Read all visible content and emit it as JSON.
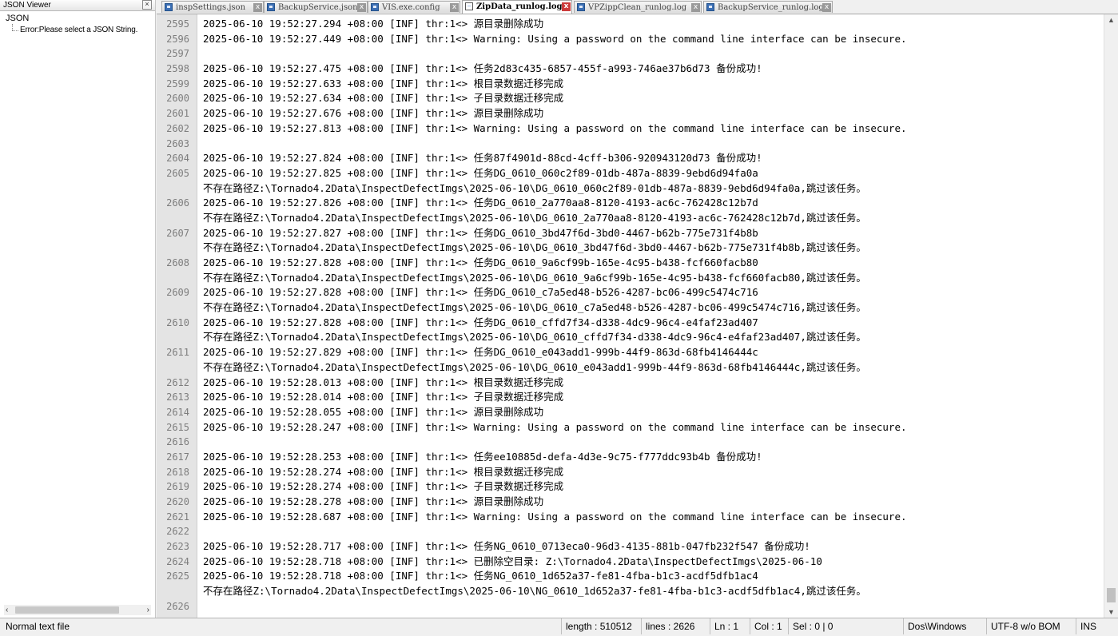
{
  "json_viewer": {
    "title": "JSON Viewer",
    "close": "×",
    "root": "JSON",
    "error": "Error:Please select a JSON String.",
    "scroll_left": "‹",
    "scroll_right": "›"
  },
  "tabs": [
    {
      "label": "inspSettings.json",
      "active": false
    },
    {
      "label": "BackupService.json",
      "active": false
    },
    {
      "label": "VIS.exe.config",
      "active": false
    },
    {
      "label": "ZipData_runlog.log",
      "active": true
    },
    {
      "label": "VPZippClean_runlog.log",
      "active": false
    },
    {
      "label": "BackupService_runlog.log",
      "active": false
    }
  ],
  "editor": {
    "lines": [
      {
        "n": "2595",
        "t": "2025-06-10 19:52:27.294 +08:00 [INF] thr:1<> 源目录删除成功"
      },
      {
        "n": "2596",
        "t": "2025-06-10 19:52:27.449 +08:00 [INF] thr:1<> Warning: Using a password on the command line interface can be insecure."
      },
      {
        "n": "2597",
        "t": ""
      },
      {
        "n": "2598",
        "t": "2025-06-10 19:52:27.475 +08:00 [INF] thr:1<> 任务2d83c435-6857-455f-a993-746ae37b6d73 备份成功!"
      },
      {
        "n": "2599",
        "t": "2025-06-10 19:52:27.633 +08:00 [INF] thr:1<> 根目录数据迁移完成"
      },
      {
        "n": "2600",
        "t": "2025-06-10 19:52:27.634 +08:00 [INF] thr:1<> 子目录数据迁移完成"
      },
      {
        "n": "2601",
        "t": "2025-06-10 19:52:27.676 +08:00 [INF] thr:1<> 源目录删除成功"
      },
      {
        "n": "2602",
        "t": "2025-06-10 19:52:27.813 +08:00 [INF] thr:1<> Warning: Using a password on the command line interface can be insecure."
      },
      {
        "n": "2603",
        "t": ""
      },
      {
        "n": "2604",
        "t": "2025-06-10 19:52:27.824 +08:00 [INF] thr:1<> 任务87f4901d-88cd-4cff-b306-920943120d73 备份成功!"
      },
      {
        "n": "2605",
        "t": "2025-06-10 19:52:27.825 +08:00 [INF] thr:1<> 任务DG_0610_060c2f89-01db-487a-8839-9ebd6d94fa0a"
      },
      {
        "n": "",
        "t": "不存在路径Z:\\Tornado4.2Data\\InspectDefectImgs\\2025-06-10\\DG_0610_060c2f89-01db-487a-8839-9ebd6d94fa0a,跳过该任务。"
      },
      {
        "n": "2606",
        "t": "2025-06-10 19:52:27.826 +08:00 [INF] thr:1<> 任务DG_0610_2a770aa8-8120-4193-ac6c-762428c12b7d"
      },
      {
        "n": "",
        "t": "不存在路径Z:\\Tornado4.2Data\\InspectDefectImgs\\2025-06-10\\DG_0610_2a770aa8-8120-4193-ac6c-762428c12b7d,跳过该任务。"
      },
      {
        "n": "2607",
        "t": "2025-06-10 19:52:27.827 +08:00 [INF] thr:1<> 任务DG_0610_3bd47f6d-3bd0-4467-b62b-775e731f4b8b"
      },
      {
        "n": "",
        "t": "不存在路径Z:\\Tornado4.2Data\\InspectDefectImgs\\2025-06-10\\DG_0610_3bd47f6d-3bd0-4467-b62b-775e731f4b8b,跳过该任务。"
      },
      {
        "n": "2608",
        "t": "2025-06-10 19:52:27.828 +08:00 [INF] thr:1<> 任务DG_0610_9a6cf99b-165e-4c95-b438-fcf660facb80"
      },
      {
        "n": "",
        "t": "不存在路径Z:\\Tornado4.2Data\\InspectDefectImgs\\2025-06-10\\DG_0610_9a6cf99b-165e-4c95-b438-fcf660facb80,跳过该任务。"
      },
      {
        "n": "2609",
        "t": "2025-06-10 19:52:27.828 +08:00 [INF] thr:1<> 任务DG_0610_c7a5ed48-b526-4287-bc06-499c5474c716"
      },
      {
        "n": "",
        "t": "不存在路径Z:\\Tornado4.2Data\\InspectDefectImgs\\2025-06-10\\DG_0610_c7a5ed48-b526-4287-bc06-499c5474c716,跳过该任务。"
      },
      {
        "n": "2610",
        "t": "2025-06-10 19:52:27.828 +08:00 [INF] thr:1<> 任务DG_0610_cffd7f34-d338-4dc9-96c4-e4faf23ad407"
      },
      {
        "n": "",
        "t": "不存在路径Z:\\Tornado4.2Data\\InspectDefectImgs\\2025-06-10\\DG_0610_cffd7f34-d338-4dc9-96c4-e4faf23ad407,跳过该任务。"
      },
      {
        "n": "2611",
        "t": "2025-06-10 19:52:27.829 +08:00 [INF] thr:1<> 任务DG_0610_e043add1-999b-44f9-863d-68fb4146444c"
      },
      {
        "n": "",
        "t": "不存在路径Z:\\Tornado4.2Data\\InspectDefectImgs\\2025-06-10\\DG_0610_e043add1-999b-44f9-863d-68fb4146444c,跳过该任务。"
      },
      {
        "n": "2612",
        "t": "2025-06-10 19:52:28.013 +08:00 [INF] thr:1<> 根目录数据迁移完成"
      },
      {
        "n": "2613",
        "t": "2025-06-10 19:52:28.014 +08:00 [INF] thr:1<> 子目录数据迁移完成"
      },
      {
        "n": "2614",
        "t": "2025-06-10 19:52:28.055 +08:00 [INF] thr:1<> 源目录删除成功"
      },
      {
        "n": "2615",
        "t": "2025-06-10 19:52:28.247 +08:00 [INF] thr:1<> Warning: Using a password on the command line interface can be insecure."
      },
      {
        "n": "2616",
        "t": ""
      },
      {
        "n": "2617",
        "t": "2025-06-10 19:52:28.253 +08:00 [INF] thr:1<> 任务ee10885d-defa-4d3e-9c75-f777ddc93b4b 备份成功!"
      },
      {
        "n": "2618",
        "t": "2025-06-10 19:52:28.274 +08:00 [INF] thr:1<> 根目录数据迁移完成"
      },
      {
        "n": "2619",
        "t": "2025-06-10 19:52:28.274 +08:00 [INF] thr:1<> 子目录数据迁移完成"
      },
      {
        "n": "2620",
        "t": "2025-06-10 19:52:28.278 +08:00 [INF] thr:1<> 源目录删除成功"
      },
      {
        "n": "2621",
        "t": "2025-06-10 19:52:28.687 +08:00 [INF] thr:1<> Warning: Using a password on the command line interface can be insecure."
      },
      {
        "n": "2622",
        "t": ""
      },
      {
        "n": "2623",
        "t": "2025-06-10 19:52:28.717 +08:00 [INF] thr:1<> 任务NG_0610_0713eca0-96d3-4135-881b-047fb232f547 备份成功!"
      },
      {
        "n": "2624",
        "t": "2025-06-10 19:52:28.718 +08:00 [INF] thr:1<> 已删除空目录: Z:\\Tornado4.2Data\\InspectDefectImgs\\2025-06-10"
      },
      {
        "n": "2625",
        "t": "2025-06-10 19:52:28.718 +08:00 [INF] thr:1<> 任务NG_0610_1d652a37-fe81-4fba-b1c3-acdf5dfb1ac4"
      },
      {
        "n": "",
        "t": "不存在路径Z:\\Tornado4.2Data\\InspectDefectImgs\\2025-06-10\\NG_0610_1d652a37-fe81-4fba-b1c3-acdf5dfb1ac4,跳过该任务。"
      },
      {
        "n": "2626",
        "t": ""
      }
    ]
  },
  "scrollbar": {
    "up": "▲",
    "down": "▼"
  },
  "statusbar": {
    "type": "Normal text file",
    "length": "length : 510512",
    "lines": "lines : 2626",
    "ln": "Ln : 1",
    "col": "Col : 1",
    "sel": "Sel : 0 | 0",
    "eol": "Dos\\Windows",
    "encoding": "UTF-8 w/o BOM",
    "mode": "INS"
  }
}
